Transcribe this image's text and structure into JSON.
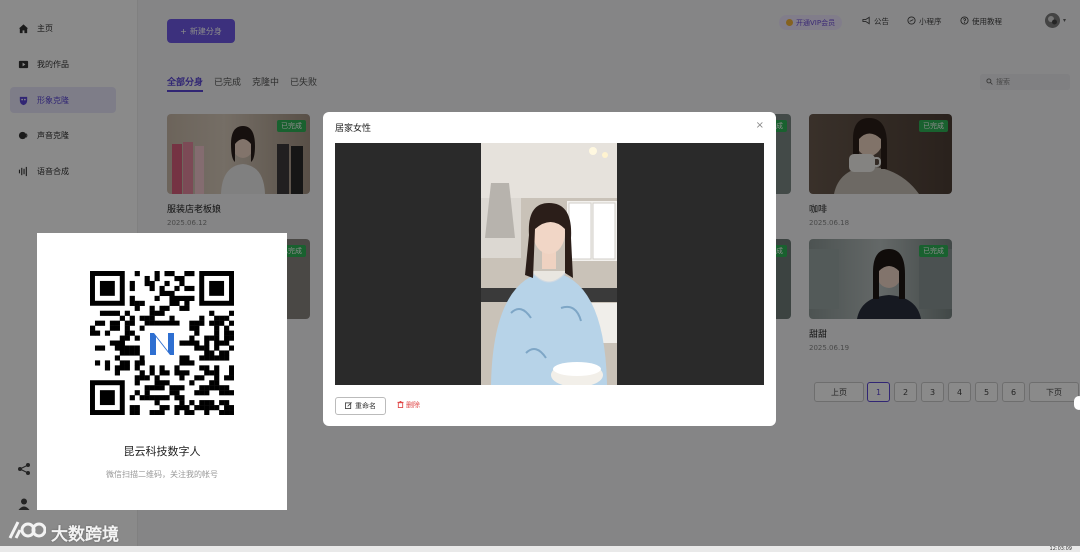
{
  "sidebar": {
    "items": [
      {
        "label": "主页",
        "icon": "home-icon"
      },
      {
        "label": "我的作品",
        "icon": "video-icon"
      },
      {
        "label": "形象克隆",
        "icon": "mask-icon",
        "active": true
      },
      {
        "label": "声音克隆",
        "icon": "voice-icon"
      },
      {
        "label": "语音合成",
        "icon": "waveform-icon"
      }
    ],
    "bottom_icons": [
      "share-icon",
      "user-icon"
    ]
  },
  "toolbar": {
    "new_button": "新建分身",
    "vip_label": "开通VIP会员",
    "links": [
      {
        "label": "公告",
        "icon": "megaphone-icon"
      },
      {
        "label": "小程序",
        "icon": "miniprogram-icon"
      },
      {
        "label": "使用教程",
        "icon": "help-icon"
      }
    ]
  },
  "tabs": [
    "全部分身",
    "已完成",
    "克隆中",
    "已失败"
  ],
  "active_tab": "全部分身",
  "search": {
    "placeholder": "搜索"
  },
  "cards": [
    {
      "title": "服装店老板娘",
      "date": "2025.06.12",
      "status": "已完成"
    },
    {
      "title": "咖啡",
      "date": "2025.06.18",
      "status": "已完成"
    },
    {
      "title": "甜甜",
      "date": "2025.06.19",
      "status": "已完成"
    },
    {
      "status": "已完成"
    },
    {
      "status": "已完成"
    },
    {
      "status": "已完成"
    }
  ],
  "pagination": {
    "prev": "上页",
    "next": "下页",
    "pages": [
      "1",
      "2",
      "3",
      "4",
      "5",
      "6"
    ],
    "current": "1"
  },
  "modal": {
    "title": "居家女性",
    "close": "×",
    "rename_label": "重命名",
    "delete_label": "删除"
  },
  "qr_card": {
    "title": "昆云科技数字人",
    "subtitle": "微信扫描二维码，关注我的帐号"
  },
  "watermark": {
    "text": "大数跨境"
  },
  "clock": "12:03:09"
}
